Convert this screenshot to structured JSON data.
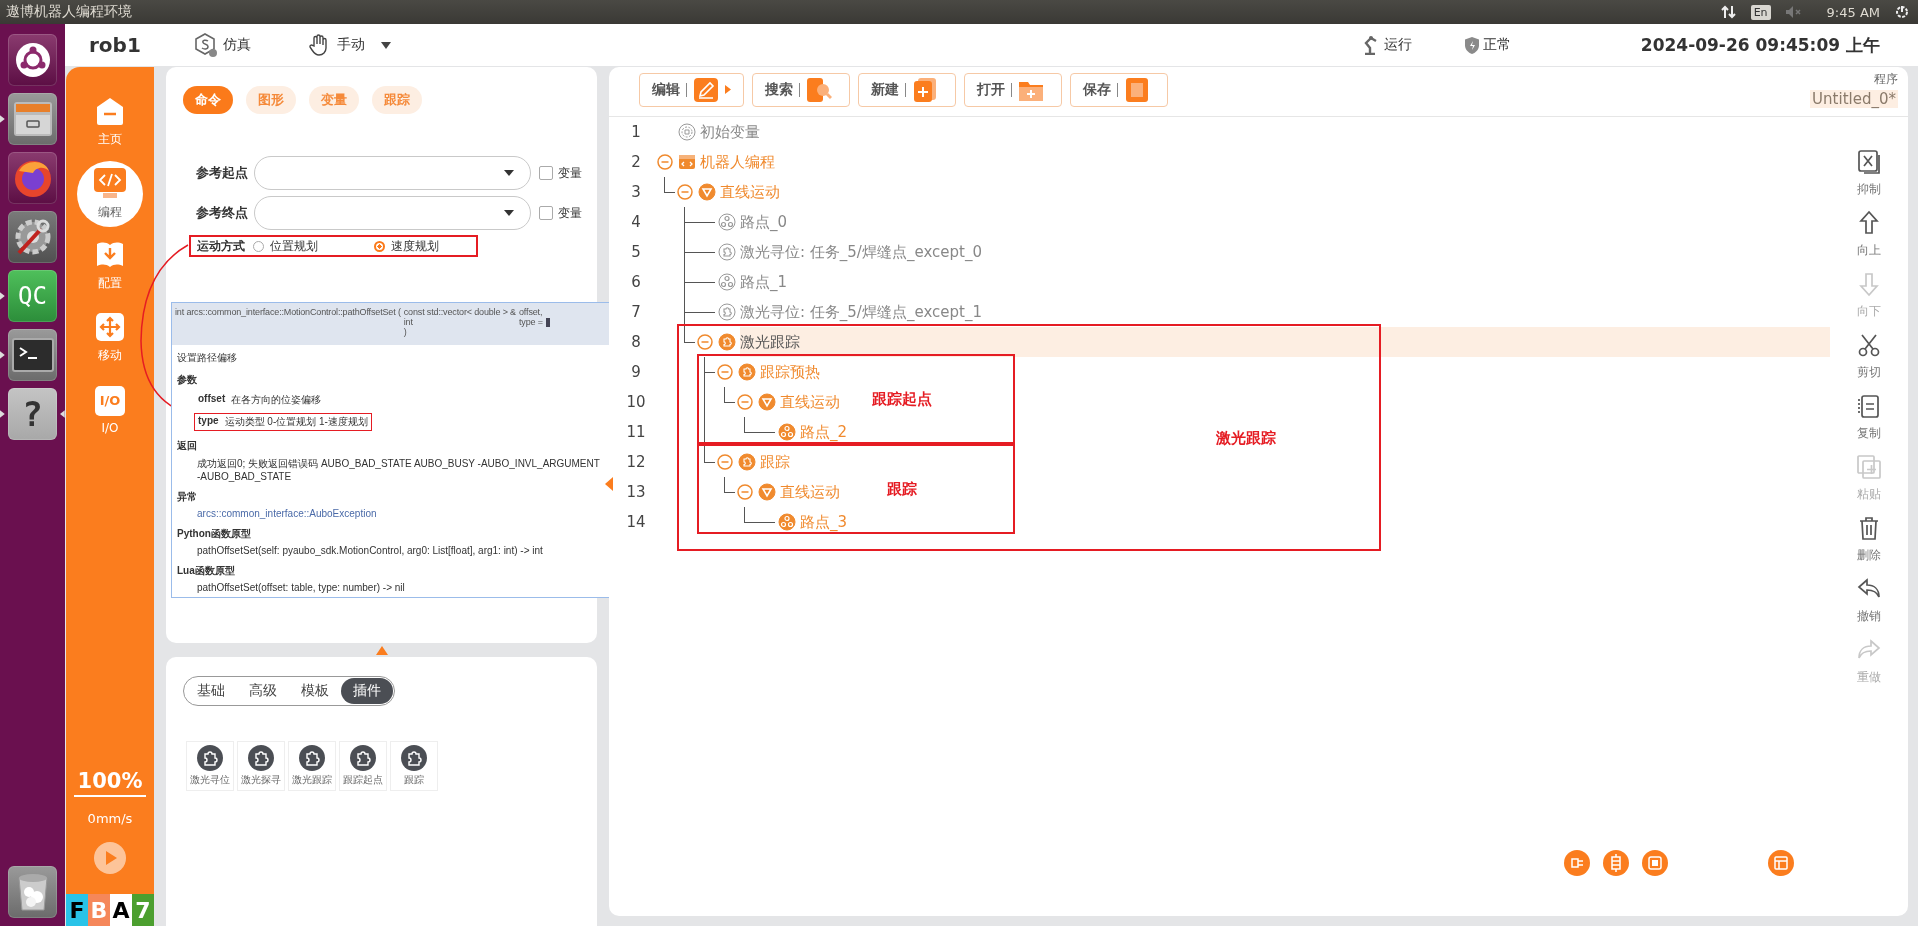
{
  "system_bar": {
    "title": "遨博机器人编程环境",
    "keyboard": "En",
    "time": "9:45 AM"
  },
  "launcher": [
    {
      "kind": "dash",
      "running": false,
      "focused": false
    },
    {
      "kind": "files",
      "running": true,
      "focused": false
    },
    {
      "kind": "browser",
      "running": false,
      "focused": false
    },
    {
      "kind": "settings",
      "running": false,
      "focused": false
    },
    {
      "kind": "qc",
      "text": "QC",
      "running": true,
      "focused": false
    },
    {
      "kind": "terminal",
      "running": true,
      "focused": false
    },
    {
      "kind": "help",
      "text": "?",
      "running": true,
      "focused": true
    },
    {
      "kind": "trash",
      "running": false,
      "focused": false
    }
  ],
  "header": {
    "robot": "rob1",
    "mode": "仿真",
    "control": "手动",
    "run_state": "运行",
    "safety": "正常",
    "datetime": "2024-09-26 09:45:09 上午"
  },
  "nav": {
    "items": [
      {
        "kind": "home",
        "label": "主页",
        "selected": false
      },
      {
        "kind": "program",
        "label": "编程",
        "selected": true
      },
      {
        "kind": "config",
        "label": "配置",
        "selected": false
      },
      {
        "kind": "move",
        "label": "移动",
        "selected": false
      },
      {
        "kind": "io",
        "label": "I/O",
        "icon_text": "I/O",
        "selected": false
      }
    ],
    "speed_ratio": "100%",
    "speed": "0mm/s",
    "play_enabled": false,
    "badges": [
      {
        "text": "F",
        "color": "#29c3e8",
        "dark_text": true
      },
      {
        "text": "B",
        "color": "#f5875a",
        "dark_text": false
      },
      {
        "text": "A",
        "color": "#ffffff",
        "dark_text": true
      },
      {
        "text": "7",
        "color": "#4c9f2f",
        "dark_text": false
      }
    ]
  },
  "command_panel": {
    "tabs": [
      {
        "label": "命令",
        "selected": true
      },
      {
        "label": "图形",
        "selected": false
      },
      {
        "label": "变量",
        "selected": false
      },
      {
        "label": "跟踪",
        "selected": false
      }
    ],
    "fields": [
      {
        "label": "参考起点",
        "checkbox": {
          "label": "变量",
          "checked": false
        }
      },
      {
        "label": "参考终点",
        "checkbox": {
          "label": "变量",
          "checked": false
        }
      }
    ],
    "motion_mode": {
      "label": "运动方式",
      "highlighted": true,
      "options": [
        {
          "label": "位置规划",
          "selected": false
        },
        {
          "label": "速度规划",
          "selected": true
        }
      ]
    },
    "doc_popup": {
      "signature": {
        "head": "int arcs::common_interface::MotionControl::pathOffsetSet (",
        "params": [
          {
            "type": "const std::vector< double > &",
            "name": "offset,"
          },
          {
            "type": "int",
            "name": "type ="
          }
        ],
        "close": ")"
      },
      "brief": "设置路径偏移",
      "params_title": "参数",
      "params": [
        {
          "name": "offset",
          "desc": "在各方向的位姿偏移",
          "highlighted": false
        },
        {
          "name": "type",
          "desc": "运动类型 0-位置规划 1-速度规划",
          "highlighted": true
        }
      ],
      "returns_title": "返回",
      "returns": "成功返回0; 失败返回错误码 AUBO_BAD_STATE AUBO_BUSY -AUBO_INVL_ARGUMENT -AUBO_BAD_STATE",
      "exceptions_title": "异常",
      "exception": "arcs::common_interface::AuboException",
      "python_title": "Python函数原型",
      "python": "pathOffsetSet(self: pyaubo_sdk.MotionControl, arg0: List[float], arg1: int) -> int",
      "lua_title": "Lua函数原型",
      "lua": "pathOffsetSet(offset: table, type: number) -> nil"
    }
  },
  "plugin_panel": {
    "tabs": [
      {
        "label": "基础",
        "selected": false
      },
      {
        "label": "高级",
        "selected": false
      },
      {
        "label": "模板",
        "selected": false
      },
      {
        "label": "插件",
        "selected": true
      }
    ],
    "plugins": [
      {
        "label": "激光寻位"
      },
      {
        "label": "激光探寻"
      },
      {
        "label": "激光跟踪"
      },
      {
        "label": "跟踪起点"
      },
      {
        "label": "跟踪"
      }
    ]
  },
  "program": {
    "toolbar": [
      {
        "kind": "edit",
        "label": "编辑",
        "menu": true
      },
      {
        "kind": "search",
        "label": "搜索",
        "menu": false
      },
      {
        "kind": "new",
        "label": "新建",
        "menu": false
      },
      {
        "kind": "open",
        "label": "打开",
        "menu": false
      },
      {
        "kind": "save",
        "label": "保存",
        "menu": false
      }
    ],
    "caption": "程序",
    "file": "Untitled_0*",
    "tree": [
      {
        "line": "1",
        "label": "初始变量",
        "kind": "variables",
        "enabled": false,
        "selected": false
      },
      {
        "line": "2",
        "label": "机器人编程",
        "kind": "program",
        "enabled": true,
        "selected": false,
        "expanded": true,
        "children": [
          {
            "line": "3",
            "label": "直线运动",
            "kind": "move",
            "enabled": true,
            "selected": false,
            "expanded": true,
            "children": [
              {
                "line": "4",
                "label": "路点_0",
                "kind": "waypoint",
                "enabled": false,
                "selected": false
              },
              {
                "line": "5",
                "label": "激光寻位: 任务_5/焊缝点_except_0",
                "kind": "plugin",
                "enabled": false,
                "selected": false
              },
              {
                "line": "6",
                "label": "路点_1",
                "kind": "waypoint",
                "enabled": false,
                "selected": false
              },
              {
                "line": "7",
                "label": "激光寻位: 任务_5/焊缝点_except_1",
                "kind": "plugin",
                "enabled": false,
                "selected": false
              },
              {
                "line": "8",
                "label": "激光跟踪",
                "kind": "plugin",
                "enabled": true,
                "selected": true,
                "expanded": true,
                "annotation": "激光跟踪",
                "children": [
                  {
                    "line": "9",
                    "label": "跟踪预热",
                    "kind": "plugin",
                    "enabled": true,
                    "selected": false,
                    "expanded": true,
                    "annotation": "跟踪起点",
                    "children": [
                      {
                        "line": "10",
                        "label": "直线运动",
                        "kind": "move",
                        "enabled": true,
                        "selected": false,
                        "expanded": true,
                        "children": [
                          {
                            "line": "11",
                            "label": "路点_2",
                            "kind": "waypoint",
                            "enabled": true,
                            "selected": false
                          }
                        ]
                      }
                    ]
                  },
                  {
                    "line": "12",
                    "label": "跟踪",
                    "kind": "plugin",
                    "enabled": true,
                    "selected": false,
                    "expanded": true,
                    "annotation": "跟踪",
                    "children": [
                      {
                        "line": "13",
                        "label": "直线运动",
                        "kind": "move",
                        "enabled": true,
                        "selected": false,
                        "expanded": true,
                        "children": [
                          {
                            "line": "14",
                            "label": "路点_3",
                            "kind": "waypoint",
                            "enabled": true,
                            "selected": false
                          }
                        ]
                      }
                    ]
                  }
                ]
              }
            ]
          }
        ]
      }
    ],
    "side_tools": [
      {
        "kind": "suppress",
        "label": "抑制",
        "disabled": false
      },
      {
        "kind": "up",
        "label": "向上",
        "disabled": false
      },
      {
        "kind": "down",
        "label": "向下",
        "disabled": true
      },
      {
        "kind": "cut",
        "label": "剪切",
        "disabled": false
      },
      {
        "kind": "copy",
        "label": "复制",
        "disabled": false
      },
      {
        "kind": "paste",
        "label": "粘贴",
        "disabled": true
      },
      {
        "kind": "delete",
        "label": "删除",
        "disabled": false
      },
      {
        "kind": "undo",
        "label": "撤销",
        "disabled": false
      },
      {
        "kind": "redo",
        "label": "重做",
        "disabled": true
      }
    ]
  }
}
